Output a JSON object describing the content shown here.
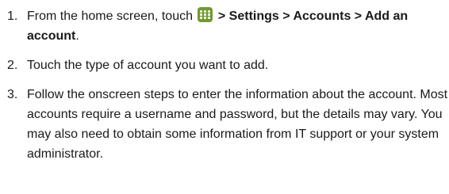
{
  "steps": [
    {
      "number": "1.",
      "prefix": "From the home screen, touch",
      "icon": "apps-grid-icon",
      "path": "> Settings > Accounts > Add an account",
      "suffix": "."
    },
    {
      "number": "2.",
      "text": "Touch the type of account you want to add."
    },
    {
      "number": "3.",
      "text": "Follow the onscreen steps to enter the information about the account. Most accounts require a username and password, but the details may vary. You may also need to obtain some information from IT support or your system administrator."
    }
  ],
  "colors": {
    "text": "#1a1a1a",
    "icon_bg": "#6f9a32"
  }
}
